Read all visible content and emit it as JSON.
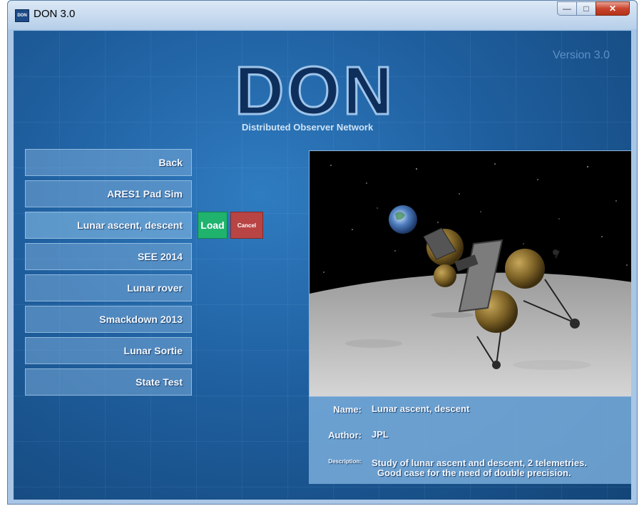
{
  "window": {
    "title": "DON 3.0",
    "icon_text": "DON"
  },
  "app": {
    "version": "Version 3.0",
    "logo": "DON",
    "logo_subtitle": "Distributed Observer Network"
  },
  "menu": {
    "items": [
      {
        "label": "Back"
      },
      {
        "label": "ARES1 Pad Sim"
      },
      {
        "label": "Lunar ascent, descent"
      },
      {
        "label": "SEE 2014"
      },
      {
        "label": "Lunar rover"
      },
      {
        "label": "Smackdown 2013"
      },
      {
        "label": "Lunar Sortie"
      },
      {
        "label": "State Test"
      }
    ],
    "selected_index": 2
  },
  "actions": {
    "load_label": "Load",
    "cancel_label": "Cancel"
  },
  "details": {
    "name_label": "Name:",
    "name_value": "Lunar ascent, descent",
    "author_label": "Author:",
    "author_value": "JPL",
    "description_label": "Description:",
    "description_line1": "Study of lunar ascent and descent, 2 telemetries.",
    "description_line2": "Good case for the need of double precision."
  },
  "colors": {
    "load_button": "#1fb36e",
    "cancel_button": "#b84444",
    "logo": "#0e2f5c"
  }
}
